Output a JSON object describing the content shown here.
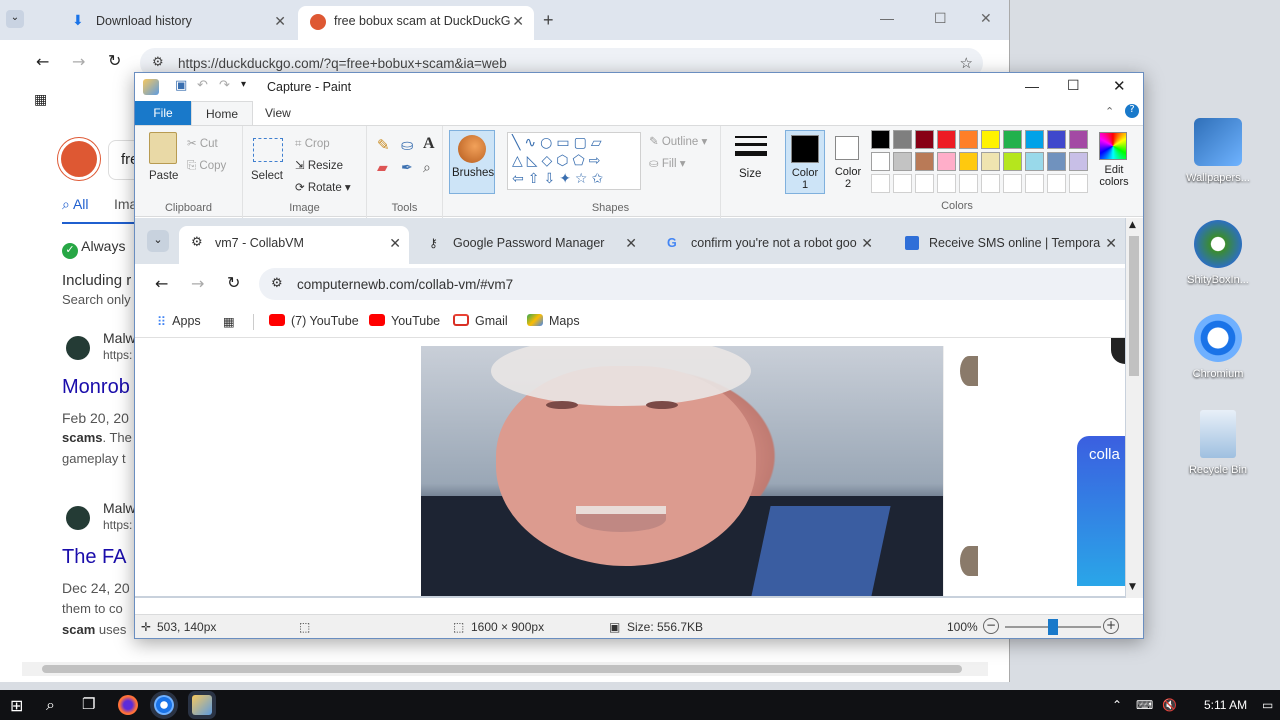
{
  "desktop": {
    "icons": [
      {
        "label": "Wallpapers...",
        "color": "#2f6fb8"
      },
      {
        "label": "ShityBoxIn...",
        "color": "#3b8c2f"
      },
      {
        "label": "Chromium",
        "color": "#1a73e8"
      },
      {
        "label": "Recycle Bin",
        "color": "#6aa0d8"
      }
    ]
  },
  "background_browser": {
    "tabs": [
      {
        "label": "Download history"
      },
      {
        "label": "free bobux scam at DuckDuckG"
      }
    ],
    "new_tab": "+",
    "url": "https://duckduckgo.com/?q=free+bobux+scam&ia=web",
    "search_partial": "fre",
    "nav_all": "All",
    "nav_images": "Ima",
    "always_partial": "Always",
    "including_partial": "Including r",
    "search_only_partial": "Search only",
    "results": [
      {
        "site": "Malw",
        "url": "https:",
        "title": "Monrob",
        "date": "Feb 20, 20",
        "snippet_bold": "scams",
        "snippet": ". The",
        "snippet2": "gameplay t"
      },
      {
        "site": "Malw",
        "url": "https:",
        "title": "The FA",
        "date": "Dec 24, 20",
        "snippet": "them to co",
        "snippet_bold": "scam",
        "snippet2": " uses"
      }
    ]
  },
  "paint": {
    "title": "Capture - Paint",
    "menu": {
      "file": "File",
      "home": "Home",
      "view": "View"
    },
    "ribbon": {
      "clipboard": {
        "paste": "Paste",
        "cut": "Cut",
        "copy": "Copy",
        "label": "Clipboard"
      },
      "image": {
        "select": "Select",
        "crop": "Crop",
        "resize": "Resize",
        "rotate": "Rotate",
        "label": "Image"
      },
      "tools": {
        "label": "Tools"
      },
      "brushes": "Brushes",
      "shapes": {
        "outline": "Outline",
        "fill": "Fill",
        "label": "Shapes"
      },
      "size": "Size",
      "color1": "Color 1",
      "color2": "Color 2",
      "edit_colors": "Edit colors",
      "colors_label": "Colors",
      "palette_row1": [
        "#000000",
        "#7f7f7f",
        "#880015",
        "#ed1c24",
        "#ff7f27",
        "#fff200",
        "#22b14c",
        "#00a2e8",
        "#3f48cc",
        "#a349a4"
      ],
      "palette_row2": [
        "#ffffff",
        "#c3c3c3",
        "#b97a57",
        "#ffaec9",
        "#ffc90e",
        "#efe4b0",
        "#b5e61d",
        "#99d9ea",
        "#7092be",
        "#c8bfe7"
      ]
    },
    "status": {
      "cursor": "503, 140px",
      "dimensions": "1600 × 900px",
      "size": "Size: 556.7KB",
      "zoom": "100%",
      "zoom_level": 0.5
    }
  },
  "captured_browser": {
    "tabs": [
      {
        "label": "vm7 - CollabVM"
      },
      {
        "label": "Google Password Manager"
      },
      {
        "label": "confirm you're not a robot goo"
      },
      {
        "label": "Receive SMS online | Tempora"
      }
    ],
    "url": "computernewb.com/collab-vm/#vm7",
    "bookmarks": [
      "Apps",
      "(7) YouTube",
      "YouTube",
      "Gmail",
      "Maps"
    ],
    "side_label": "colla"
  },
  "taskbar": {
    "time": "5:11 AM"
  }
}
